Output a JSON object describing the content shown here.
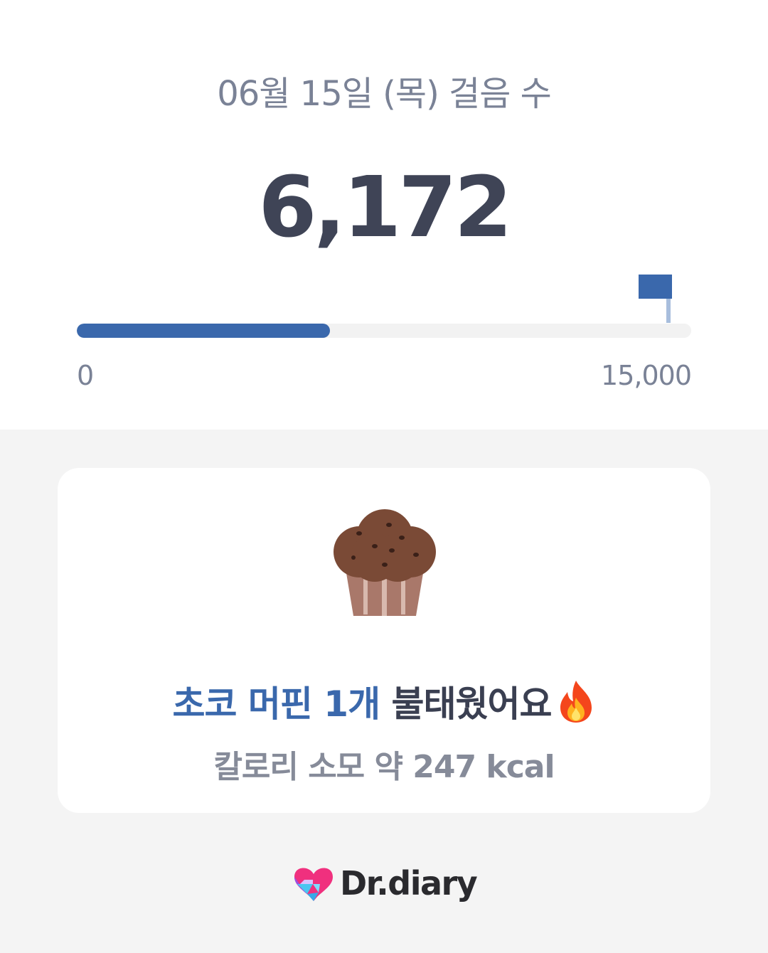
{
  "header": {
    "date_title": "06월 15일 (목) 걸음 수",
    "step_count": "6,172"
  },
  "progress": {
    "current_steps": 6172,
    "goal_steps": 15000,
    "min_label": "0",
    "max_label": "15,000",
    "fill_color": "#3a68ac",
    "flag_icon": "goal-flag-icon"
  },
  "burn_card": {
    "food_icon": "chocolate-muffin-icon",
    "highlight_text": "초코 머핀 1개",
    "rest_text": " 불태웠어요",
    "emoji_icon": "fire-icon",
    "calorie_text": "칼로리 소모 약 247 kcal"
  },
  "brand": {
    "logo_icon": "heart-logo-icon",
    "name": "Dr.diary"
  },
  "colors": {
    "accent": "#3a68ac",
    "title_gray": "#7a8296",
    "number_dark": "#3f4456",
    "background": "#f4f4f4"
  }
}
